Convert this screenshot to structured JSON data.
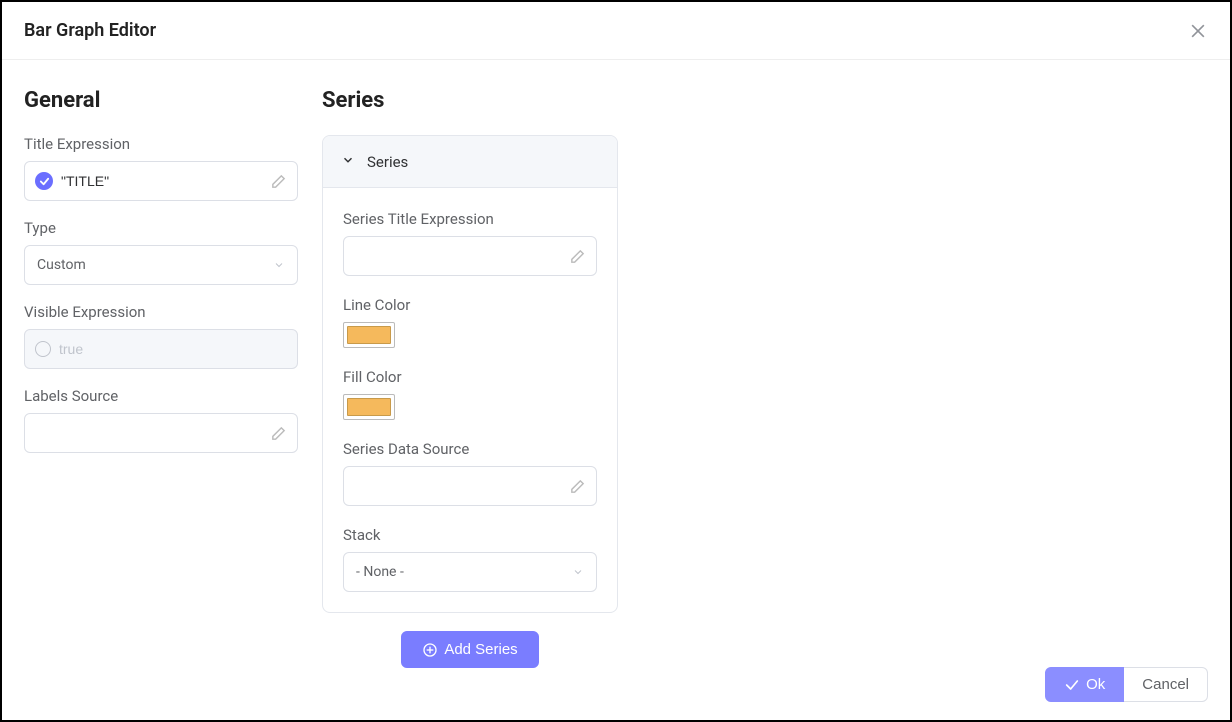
{
  "header": {
    "title": "Bar Graph Editor"
  },
  "general": {
    "heading": "General",
    "titleExpression": {
      "label": "Title Expression",
      "value": "\"TITLE\""
    },
    "type": {
      "label": "Type",
      "value": "Custom"
    },
    "visibleExpression": {
      "label": "Visible Expression",
      "placeholder": "true"
    },
    "labelsSource": {
      "label": "Labels Source",
      "value": ""
    }
  },
  "series": {
    "heading": "Series",
    "card": {
      "title": "Series",
      "titleExpression": {
        "label": "Series Title Expression",
        "value": ""
      },
      "lineColor": {
        "label": "Line Color",
        "value": "#f5b95c"
      },
      "fillColor": {
        "label": "Fill Color",
        "value": "#f5b95c"
      },
      "dataSource": {
        "label": "Series Data Source",
        "value": ""
      },
      "stack": {
        "label": "Stack",
        "value": "- None -"
      }
    },
    "addButton": "Add Series"
  },
  "footer": {
    "ok": "Ok",
    "cancel": "Cancel"
  }
}
